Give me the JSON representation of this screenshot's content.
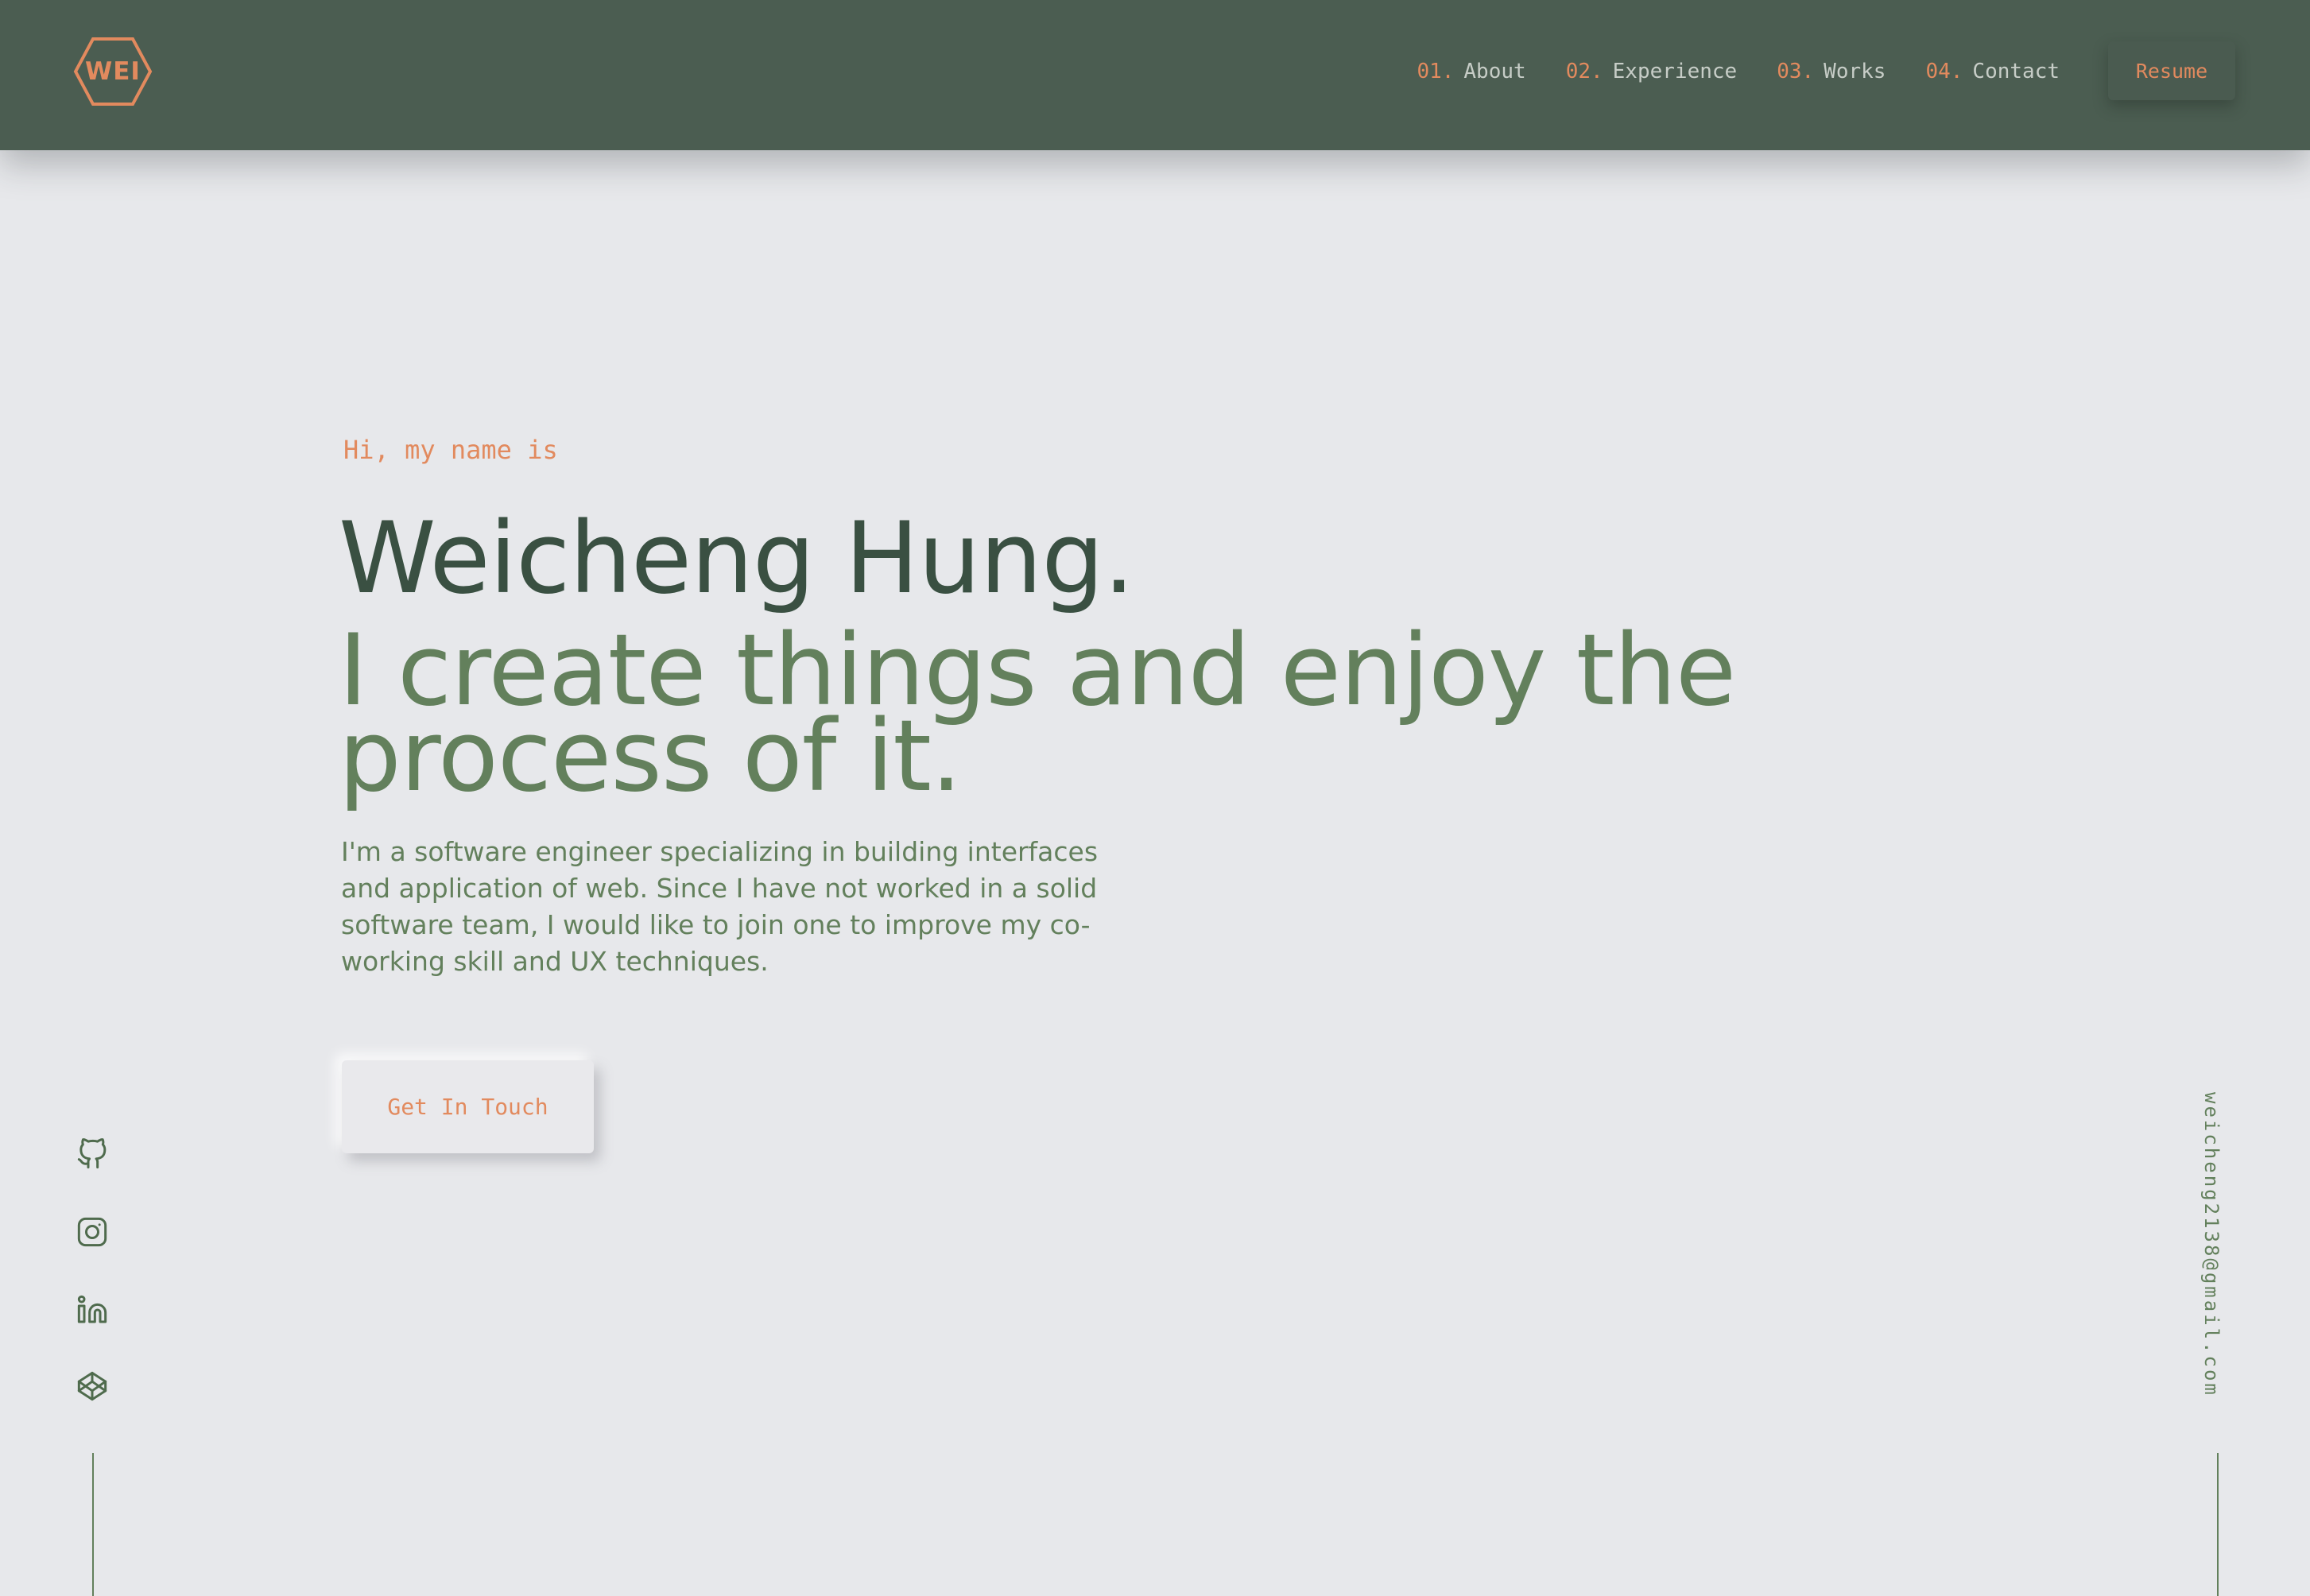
{
  "header": {
    "logo_text": "WEI",
    "nav": [
      {
        "num": "01.",
        "label": "About"
      },
      {
        "num": "02.",
        "label": "Experience"
      },
      {
        "num": "03.",
        "label": "Works"
      },
      {
        "num": "04.",
        "label": "Contact"
      }
    ],
    "resume_label": "Resume"
  },
  "hero": {
    "greeting": "Hi, my name is",
    "name": "Weicheng Hung.",
    "tagline_lines": [
      "I create things and enjoy the",
      "process of it."
    ],
    "bio_lines": [
      "I'm a software engineer specializing in building interfaces",
      "and application of web. Since I have not worked in a solid",
      "software team, I would like to join one to improve my co-",
      "working skill and UX techniques."
    ],
    "cta_label": "Get In Touch"
  },
  "social": {
    "icons": [
      "github-icon",
      "instagram-icon",
      "linkedin-icon",
      "codepen-icon"
    ]
  },
  "email": "weicheng2138@gmail.com",
  "colors": {
    "header_bg": "#4b5d51",
    "page_bg": "#e7e8eb",
    "accent": "#e28a5e",
    "heading_dark": "#3a5042",
    "green": "#63805c",
    "nav_text": "#c7cdc7"
  }
}
